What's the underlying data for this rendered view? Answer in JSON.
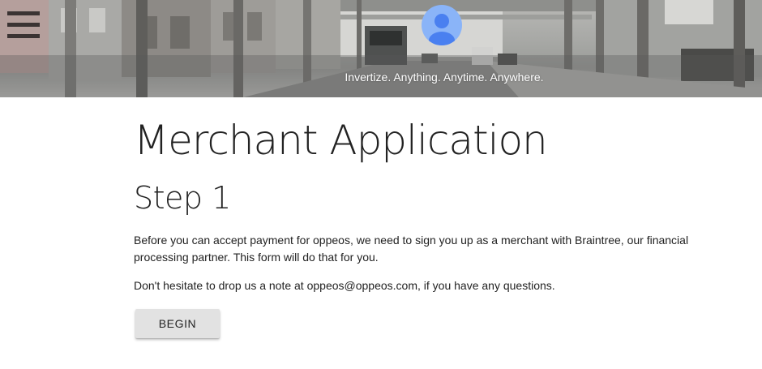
{
  "header": {
    "menu_icon": "hamburger-menu-icon",
    "avatar_icon": "user-account-icon",
    "tagline": "Invertize. Anything. Anytime. Anywhere."
  },
  "main": {
    "title": "Merchant Application",
    "step": "Step 1",
    "paragraph1": "Before you can accept payment for oppeos, we need to sign you up as a merchant with Braintree, our financial processing partner. This form will do that for you.",
    "paragraph2": "Don't hesitate to drop us a note at oppeos@oppeos.com, if you have any questions.",
    "begin_label": "BEGIN"
  },
  "colors": {
    "avatar_bg": "#8ab4f8",
    "avatar_fg": "#4a80f0",
    "button_bg": "#e2e2e2",
    "menu_bars": "#3b3333"
  }
}
